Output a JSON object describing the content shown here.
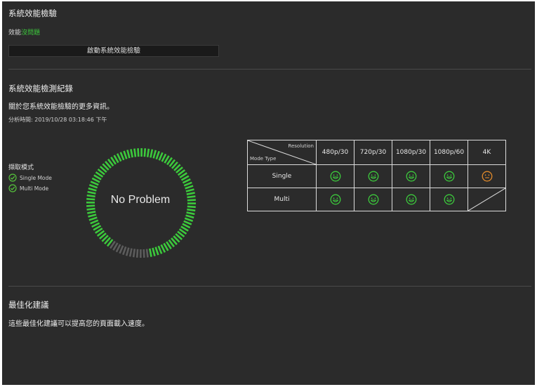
{
  "header": {
    "title": "系統效能檢驗",
    "status_prefix": "效能",
    "status_value": "沒問題",
    "run_button": "啟動系統效能檢驗"
  },
  "history": {
    "title": "系統效能檢測紀錄",
    "more_info": "關於您系統效能檢驗的更多資訊。",
    "analysis_time": "分析時間: 2019/10/28 03:18:46 下午"
  },
  "capture_mode": {
    "title": "擷取模式",
    "options": [
      "Single Mode",
      "Multi Mode"
    ],
    "check_color": "#55c23b"
  },
  "gauge": {
    "label": "No Problem",
    "pass_fraction": 0.88,
    "pass_color": "#3cc93c",
    "remaining_color": "#5c5c5c"
  },
  "matrix": {
    "header_resolution": "Resolution",
    "header_mode_type": "Mode Type",
    "resolutions": [
      "480p/30",
      "720p/30",
      "1080p/30",
      "1080p/60",
      "4K"
    ],
    "rows": [
      {
        "mode": "Single",
        "status": [
          "good",
          "good",
          "good",
          "good",
          "fair"
        ]
      },
      {
        "mode": "Multi",
        "status": [
          "good",
          "good",
          "good",
          "good",
          "na"
        ]
      }
    ],
    "status_colors": {
      "good": "#3cc93c",
      "fair": "#e0892a"
    }
  },
  "optimization": {
    "title": "最佳化建議",
    "description": "這些最佳化建議可以提高您的頁面載入速度。"
  }
}
